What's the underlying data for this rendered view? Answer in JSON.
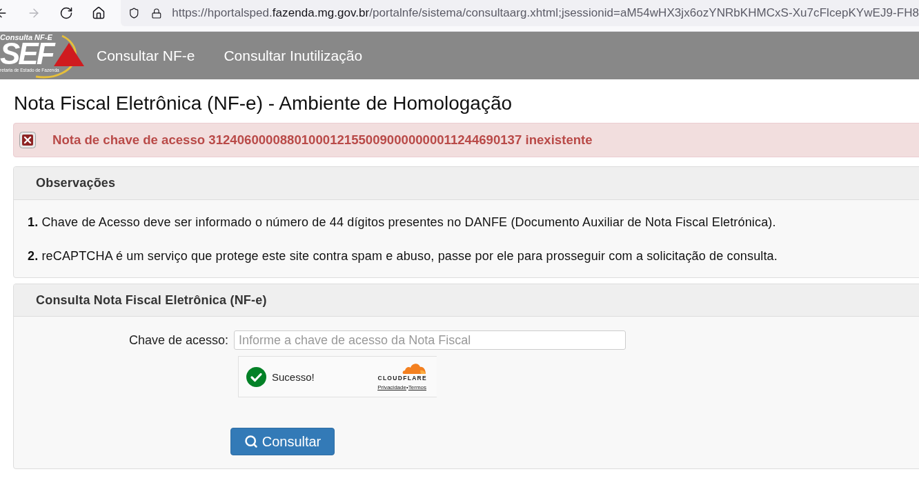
{
  "browser": {
    "forward": {
      "disabled": true
    },
    "url": {
      "prefix": "https://hportalsped.",
      "domain": "fazenda.mg.gov.br",
      "path": "/portalnfe/sistema/consultaarg.xhtml;jsessionid=aM54wHX3jx6ozYNRbKHMCxS-Xu7cFlcepKYwEJ9-FH8"
    }
  },
  "header": {
    "logo": {
      "caption": "Consulta NF-E",
      "wordmark": "SEF",
      "subtitle": "retaria de Estado de Fazenda"
    },
    "menu": [
      {
        "label": "Consultar NF-e"
      },
      {
        "label": "Consultar Inutilização"
      }
    ]
  },
  "title": "Nota Fiscal Eletrônica (NF-e) - Ambiente de Homologação",
  "alert": {
    "kind": "error",
    "message": "Nota de chave de acesso 31240600008801000121550090000000011244690137 inexistente"
  },
  "observations": {
    "title": "Observações",
    "items": [
      "**1.** Chave de Acesso deve ser informado o número de 44 dígitos presentes no DANFE (Documento Auxiliar de Nota Fiscal Eletrónica).",
      "**2.** reCAPTCHA é um serviço que protege este site contra spam e abuso, passe por ele para prosseguir com a solicitação de consulta."
    ]
  },
  "query": {
    "title": "Consulta Nota Fiscal Eletrônica (NF-e)",
    "field": {
      "label": "Chave de acesso:",
      "placeholder": "Informe a chave de acesso da Nota Fiscal"
    },
    "captcha": {
      "verified": true,
      "status": "Sucesso!",
      "brand": "CLOUDFLARE",
      "links": [
        "Privacidade",
        "Termos"
      ],
      "separator": "•"
    },
    "button": "Consultar"
  }
}
